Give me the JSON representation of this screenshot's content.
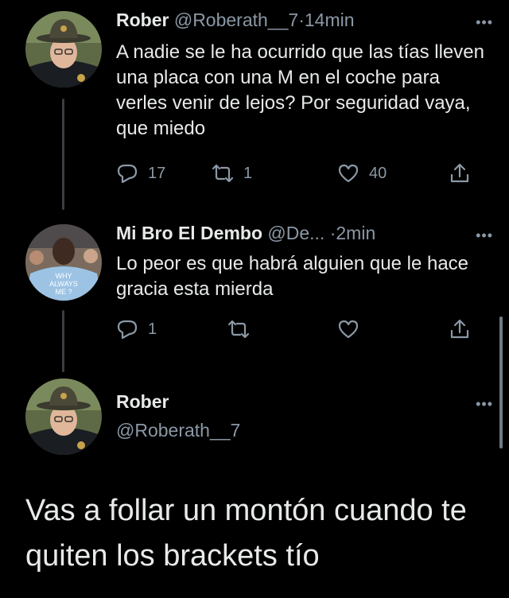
{
  "tweets": [
    {
      "name": "Rober",
      "handle": "@Roberath__7",
      "sep": "·",
      "time": "14min",
      "more": "•••",
      "text": "A nadie se le ha ocurrido que las tías lleven una placa con una M en el coche para verles venir de lejos? Por seguridad vaya, que miedo",
      "replies": "17",
      "retweets": "1",
      "likes": "40"
    },
    {
      "name": "Mi Bro El Dembo",
      "handle": "@De...",
      "sep": "·",
      "time": "2min",
      "more": "•••",
      "text": "Lo peor es que habrá alguien que le hace gracia esta mierda",
      "replies": "1",
      "avatar_shirt_text": "WHY ALWAYS ME ?"
    }
  ],
  "main_tweet": {
    "name": "Rober",
    "handle": "@Roberath__7",
    "more": "•••",
    "text": "Vas a follar un montón cuando te quiten los brackets tío"
  },
  "icons": {
    "reply": "reply-icon",
    "retweet": "retweet-icon",
    "like": "heart-icon",
    "share": "share-icon"
  }
}
